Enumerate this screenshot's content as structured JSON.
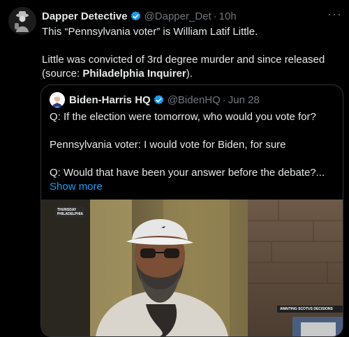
{
  "tweet": {
    "author_name": "Dapper Detective",
    "author_handle": "@Dapper_Det",
    "separator": "·",
    "time": "10h",
    "more_label": "···",
    "text_line1": "This “Pennsylvania voter” is William Latif Little.",
    "text_line2": "Little was convicted of 3rd degree murder and since released",
    "text_line3_prefix": "(source: ",
    "text_line3_bold": "Philadelphia Inquirer",
    "text_line3_suffix": ")."
  },
  "quote": {
    "author_name": "Biden-Harris HQ",
    "author_handle": "@BidenHQ",
    "separator": "·",
    "date": "Jun 28",
    "line1": "Q: If the election were tomorrow, who would you vote for?",
    "line2": "Pennsylvania voter: I would vote for Biden, for sure",
    "line3": "Q: Would that have been your answer before the debate?...",
    "show_more": "Show more"
  },
  "media": {
    "chyron_top_line1": "THURSDAY",
    "chyron_top_line2": "PHILADELPHIA",
    "chyron_bottom": "AWAITING SCOTUS DECISIONS"
  },
  "icons": {
    "verified": "verified-badge-icon",
    "more": "more-options-icon"
  },
  "colors": {
    "background": "#000000",
    "text_primary": "#e7e9ea",
    "text_secondary": "#71767b",
    "accent": "#1d9bf0",
    "border": "#2f3336"
  }
}
